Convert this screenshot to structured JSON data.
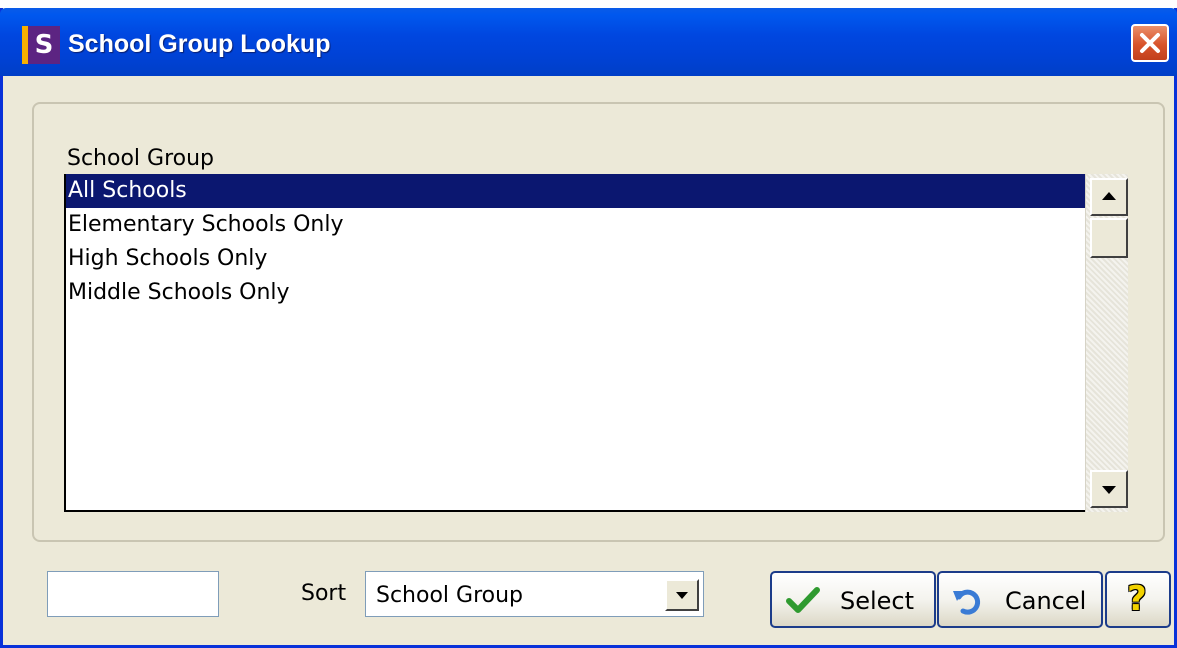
{
  "window": {
    "title": "School Group Lookup",
    "icon_letter": "S"
  },
  "list": {
    "column_header": "School Group",
    "items": [
      {
        "label": "All Schools",
        "selected": true
      },
      {
        "label": "Elementary Schools Only",
        "selected": false
      },
      {
        "label": "High Schools Only",
        "selected": false
      },
      {
        "label": "Middle Schools Only",
        "selected": false
      }
    ]
  },
  "filter": {
    "value": ""
  },
  "sort": {
    "label": "Sort",
    "selected": "School Group"
  },
  "buttons": {
    "select": "Select",
    "cancel": "Cancel",
    "help": "?"
  },
  "icons": {
    "app": "app-s-icon",
    "close": "close-icon",
    "scroll_up": "arrow-up-icon",
    "scroll_down": "arrow-down-icon",
    "dropdown": "chevron-down-icon",
    "select": "checkmark-icon",
    "cancel": "undo-arrow-icon",
    "help": "question-mark-icon"
  },
  "colors": {
    "title_bar": "#0047e0",
    "selection": "#0b1770",
    "close": "#d8532b",
    "window_bg": "#ece9d8"
  }
}
